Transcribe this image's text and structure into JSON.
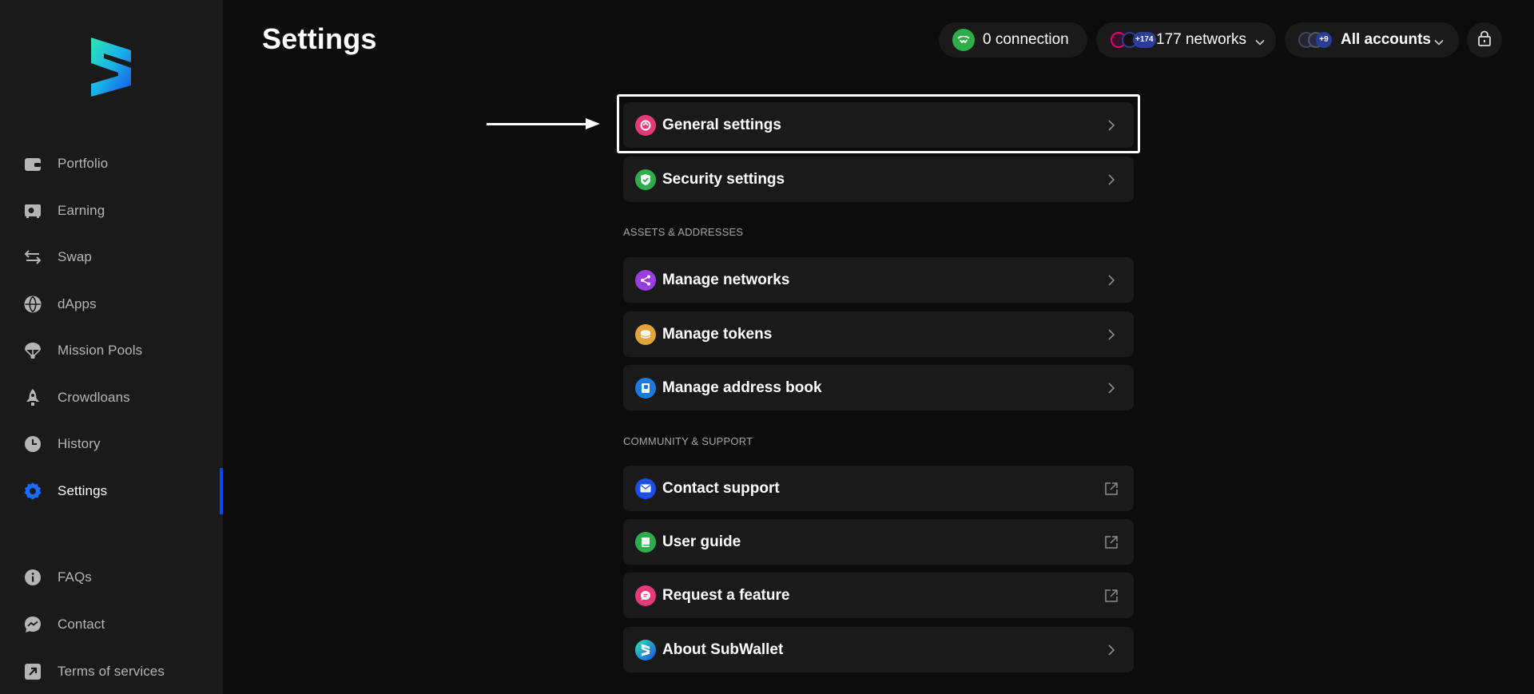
{
  "page": {
    "title": "Settings"
  },
  "sidebar": {
    "items": [
      {
        "label": "Portfolio",
        "icon": "wallet-icon"
      },
      {
        "label": "Earning",
        "icon": "safe-icon"
      },
      {
        "label": "Swap",
        "icon": "swap-arrows-icon"
      },
      {
        "label": "dApps",
        "icon": "globe-icon"
      },
      {
        "label": "Mission Pools",
        "icon": "parachute-icon"
      },
      {
        "label": "Crowdloans",
        "icon": "rocket-icon"
      },
      {
        "label": "History",
        "icon": "clock-icon"
      },
      {
        "label": "Settings",
        "icon": "gear-icon",
        "active": true
      }
    ],
    "bottom_items": [
      {
        "label": "FAQs",
        "icon": "info-icon"
      },
      {
        "label": "Contact",
        "icon": "chat-icon"
      },
      {
        "label": "Terms of services",
        "icon": "external-link-icon"
      }
    ]
  },
  "header": {
    "connection_label": "0 connection",
    "networks_label": "177 networks",
    "networks_badge": "+174",
    "accounts_label": "All accounts",
    "accounts_badge": "+9"
  },
  "settings": {
    "general": [
      {
        "label": "General settings",
        "icon": "general-settings-icon",
        "color": "#e5397a",
        "action": "chevron"
      },
      {
        "label": "Security settings",
        "icon": "shield-icon",
        "color": "#2dae4a",
        "action": "chevron"
      }
    ],
    "assets_title": "ASSETS & ADDRESSES",
    "assets": [
      {
        "label": "Manage networks",
        "icon": "share-nodes-icon",
        "color": "#9a3de0",
        "action": "chevron"
      },
      {
        "label": "Manage tokens",
        "icon": "coins-icon",
        "color": "#e0a63a",
        "action": "chevron"
      },
      {
        "label": "Manage address book",
        "icon": "address-book-icon",
        "color": "#1b7ae0",
        "action": "chevron"
      }
    ],
    "community_title": "COMMUNITY & SUPPORT",
    "community": [
      {
        "label": "Contact support",
        "icon": "envelope-icon",
        "color": "#1d4ee8",
        "action": "external"
      },
      {
        "label": "User guide",
        "icon": "book-icon",
        "color": "#2dae4a",
        "action": "external"
      },
      {
        "label": "Request a feature",
        "icon": "message-icon",
        "color": "#e5397a",
        "action": "external"
      },
      {
        "label": "About SubWallet",
        "icon": "subwallet-logo-icon",
        "color": "#1fb6c8",
        "action": "chevron"
      }
    ]
  },
  "colors": {
    "accent": "#004bff",
    "background": "#0c0c0c",
    "surface": "#1a1a1a"
  }
}
